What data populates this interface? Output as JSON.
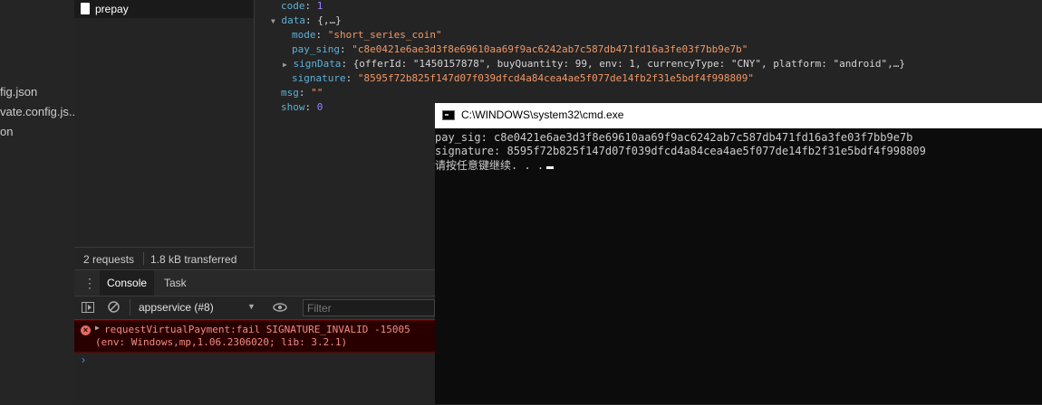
{
  "file_pane": {
    "items": [
      "fig.json",
      "vate.config.js...",
      "on"
    ]
  },
  "network": {
    "request_name": "prepay",
    "status": {
      "requests": "2 requests",
      "transferred": "1.8 kB transferred"
    }
  },
  "preview": {
    "code_key": "code",
    "code_val": "1",
    "data_key": "data",
    "data_collapsed": "{,…}",
    "mode_key": "mode",
    "mode_val": "\"short_series_coin\"",
    "paysing_key": "pay_sing",
    "paysing_val": "\"c8e0421e6ae3d3f8e69610aa69f9ac6242ab7c587db471fd16a3fe03f7bb9e7b\"",
    "signdata_key": "signData",
    "signdata_val": "{offerId: \"1450157878\", buyQuantity: 99, env: 1, currencyType: \"CNY\", platform: \"android\",…}",
    "signature_key": "signature",
    "signature_val": "\"8595f72b825f147d07f039dfcd4a84cea4ae5f077de14fb2f31e5bdf4f998809\"",
    "msg_key": "msg",
    "msg_val": "\"\"",
    "show_key": "show",
    "show_val": "0"
  },
  "console": {
    "tabs": [
      "Console",
      "Task"
    ],
    "context": "appservice (#8)",
    "filter_placeholder": "Filter",
    "error_line1": "requestVirtualPayment:fail SIGNATURE_INVALID -15005",
    "error_line2": "(env: Windows,mp,1.06.2306020; lib: 3.2.1)",
    "prompt": "›"
  },
  "cmd": {
    "title": "C:\\WINDOWS\\system32\\cmd.exe",
    "lines": [
      "pay_sig: c8e0421e6ae3d3f8e69610aa69f9ac6242ab7c587db471fd16a3fe03f7bb9e7b",
      "signature: 8595f72b825f147d07f039dfcd4a84cea4ae5f077de14fb2f31e5bdf4f998809",
      "请按任意键继续. . ."
    ]
  },
  "colors": {
    "json_key": "#5db0d7",
    "json_string": "#f29766",
    "json_number": "#9980ff",
    "error_text": "#f28b82",
    "error_bg": "#290000"
  }
}
